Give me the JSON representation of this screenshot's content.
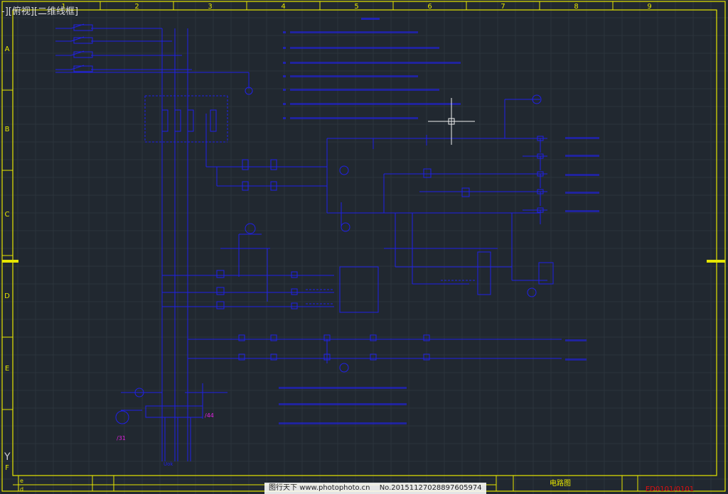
{
  "viewport": {
    "label": "-][俯视][二维线框]",
    "ucs_label": "Y"
  },
  "frame": {
    "columns": [
      "1",
      "2",
      "3",
      "4",
      "5",
      "6",
      "7",
      "8",
      "9"
    ],
    "rows": [
      "A",
      "B",
      "C",
      "D",
      "E",
      "F"
    ],
    "frame_color": "#e6e600"
  },
  "title_block": {
    "revision_marks": [
      "e",
      "d"
    ],
    "drawing_title": "电路图",
    "drawing_number": "ED0101/0101",
    "number_color": "#e01010"
  },
  "drawing": {
    "wire_color": "#2020e8",
    "tag_color": "#e020e0",
    "off_page_refs": [
      "/44",
      "/31"
    ],
    "bottom_mark": "Uok"
  },
  "watermark": {
    "site": "图行天下",
    "url": "www.photophoto.cn",
    "number": "No.20151127028897605974"
  }
}
